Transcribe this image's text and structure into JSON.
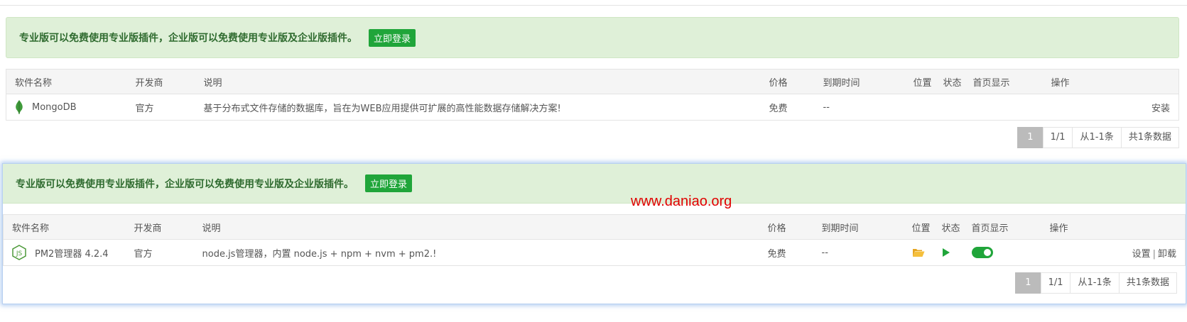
{
  "panels": [
    {
      "banner_text": "专业版可以免费使用专业版插件，企业版可以免费使用专业版及企业版插件。",
      "login_label": "立即登录",
      "columns": [
        "软件名称",
        "开发商",
        "说明",
        "价格",
        "到期时间",
        "位置",
        "状态",
        "首页显示",
        "操作"
      ],
      "row": {
        "name": "MongoDB",
        "icon": "mongodb-leaf-icon",
        "vendor": "官方",
        "description": "基于分布式文件存储的数据库，旨在为WEB应用提供可扩展的高性能数据存储解决方案!",
        "price": "免费",
        "expiry": "--",
        "action": "安装"
      },
      "pager": {
        "current": "1",
        "pages": "1/1",
        "range": "从1-1条",
        "total": "共1条数据"
      }
    },
    {
      "banner_text": "专业版可以免费使用专业版插件，企业版可以免费使用专业版及企业版插件。",
      "login_label": "立即登录",
      "columns": [
        "软件名称",
        "开发商",
        "说明",
        "价格",
        "到期时间",
        "位置",
        "状态",
        "首页显示",
        "操作"
      ],
      "row": {
        "name": "PM2管理器 4.2.4",
        "icon": "nodejs-hexagon-icon",
        "vendor": "官方",
        "description": "node.js管理器，内置 node.js + npm + nvm + pm2.!",
        "price": "免费",
        "expiry": "--",
        "position_icon": "folder-open-icon",
        "status_icon": "play-icon",
        "homepage_toggle": true,
        "action_settings": "设置",
        "action_separator": "|",
        "action_uninstall": "卸载"
      },
      "pager": {
        "current": "1",
        "pages": "1/1",
        "range": "从1-1条",
        "total": "共1条数据"
      }
    }
  ],
  "watermark": "www.daniao.org",
  "colors": {
    "accent": "#20a53a",
    "banner_bg": "#dff0d8",
    "watermark": "#e00000",
    "folder": "#f0b030"
  }
}
